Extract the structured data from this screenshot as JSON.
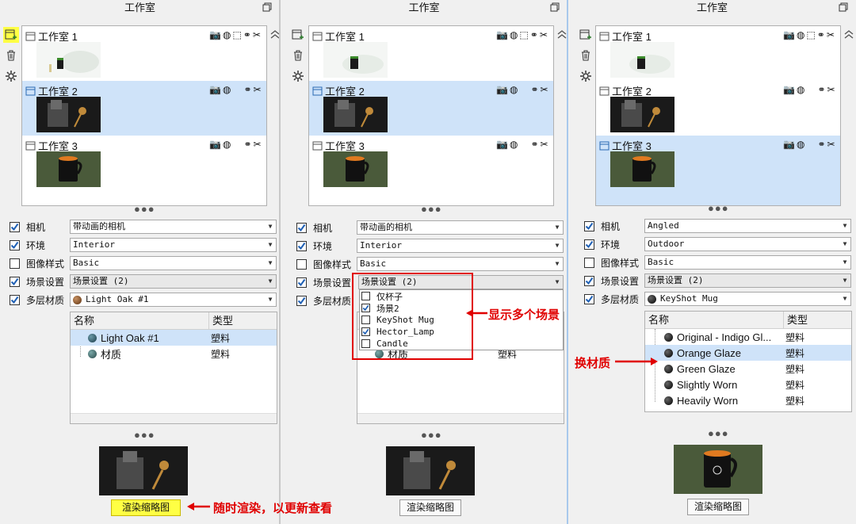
{
  "panels": [
    {
      "title": "工作室",
      "studios": [
        {
          "name": "工作室 1",
          "selected": false
        },
        {
          "name": "工作室 2",
          "selected": true
        },
        {
          "name": "工作室 3",
          "selected": false
        }
      ],
      "props": [
        {
          "label": "相机",
          "checked": true,
          "value": "带动画的相机"
        },
        {
          "label": "环境",
          "checked": true,
          "value": "Interior"
        },
        {
          "label": "图像样式",
          "checked": false,
          "value": "Basic"
        },
        {
          "label": "场景设置",
          "checked": true,
          "value": "场景设置 (2)"
        },
        {
          "label": "多层材质",
          "checked": true,
          "value": "Light Oak #1"
        }
      ],
      "materials": {
        "col_name": "名称",
        "col_type": "类型",
        "rows": [
          {
            "name": "Light Oak #1",
            "type": "塑料",
            "selected": true
          },
          {
            "name": "材质",
            "type": "塑料",
            "selected": false
          }
        ]
      },
      "render_button": "渲染缩略图"
    },
    {
      "title": "工作室",
      "studios": [
        {
          "name": "工作室 1",
          "selected": false
        },
        {
          "name": "工作室 2",
          "selected": true
        },
        {
          "name": "工作室 3",
          "selected": false
        }
      ],
      "props": [
        {
          "label": "相机",
          "checked": true,
          "value": "带动画的相机"
        },
        {
          "label": "环境",
          "checked": true,
          "value": "Interior"
        },
        {
          "label": "图像样式",
          "checked": false,
          "value": "Basic"
        },
        {
          "label": "场景设置",
          "checked": true,
          "value": "场景设置 (2)"
        },
        {
          "label": "多层材质",
          "checked": true,
          "value": ""
        }
      ],
      "materials": {
        "col_name": "名称",
        "col_type": "类型",
        "rows": [
          {
            "name": "",
            "type": "",
            "selected": false
          },
          {
            "name": "材质",
            "type": "塑料",
            "selected": false
          }
        ]
      },
      "scene_dropdown": [
        {
          "label": "仅杯子",
          "checked": false
        },
        {
          "label": "场景2",
          "checked": true
        },
        {
          "label": "KeyShot Mug",
          "checked": false
        },
        {
          "label": "Hector_Lamp",
          "checked": true
        },
        {
          "label": "Candle",
          "checked": false
        }
      ],
      "render_button": "渲染缩略图"
    },
    {
      "title": "工作室",
      "studios": [
        {
          "name": "工作室 1",
          "selected": false
        },
        {
          "name": "工作室 2",
          "selected": false
        },
        {
          "name": "工作室 3",
          "selected": true
        }
      ],
      "props": [
        {
          "label": "相机",
          "checked": true,
          "value": "Angled"
        },
        {
          "label": "环境",
          "checked": true,
          "value": "Outdoor"
        },
        {
          "label": "图像样式",
          "checked": false,
          "value": "Basic"
        },
        {
          "label": "场景设置",
          "checked": true,
          "value": "场景设置 (2)"
        },
        {
          "label": "多层材质",
          "checked": true,
          "value": "KeyShot Mug"
        }
      ],
      "materials": {
        "col_name": "名称",
        "col_type": "类型",
        "rows": [
          {
            "name": "Original - Indigo Gl...",
            "type": "塑料",
            "selected": false
          },
          {
            "name": "Orange Glaze",
            "type": "塑料",
            "selected": true
          },
          {
            "name": "Green Glaze",
            "type": "塑料",
            "selected": false
          },
          {
            "name": "Slightly Worn",
            "type": "塑料",
            "selected": false
          },
          {
            "name": "Heavily Worn",
            "type": "塑料",
            "selected": false
          }
        ]
      },
      "render_button": "渲染缩略图"
    }
  ],
  "annotations": {
    "multi_scene": "显示多个场景",
    "swap_material": "换材质",
    "render_anytime": "随时渲染，以更新查看"
  },
  "colors": {
    "selection": "#cfe3f9",
    "highlight": "#ffff44",
    "annotation": "#e00000",
    "checkbox_blue": "#1e5fb4"
  }
}
